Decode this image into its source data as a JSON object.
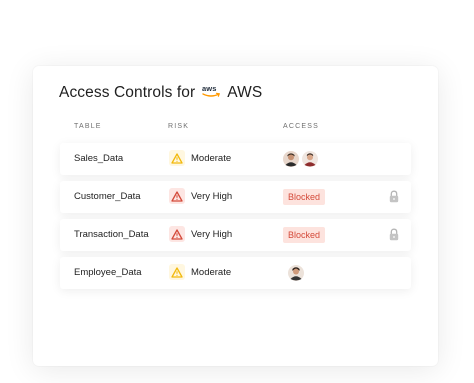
{
  "card": {
    "title": "Access Controls for",
    "provider_logo": "aws-logo",
    "provider_name": "AWS"
  },
  "columns": {
    "table": "TABLE",
    "risk": "RISK",
    "access": "ACCESS"
  },
  "rows": [
    {
      "table": "Sales_Data",
      "risk": "Moderate",
      "risk_level": "moderate",
      "access": "avatars",
      "avatars": 2,
      "locked": false
    },
    {
      "table": "Customer_Data",
      "risk": "Very High",
      "risk_level": "high",
      "access": "Blocked",
      "locked": true
    },
    {
      "table": "Transaction_Data",
      "risk": "Very High",
      "risk_level": "high",
      "access": "Blocked",
      "locked": true
    },
    {
      "table": "Employee_Data",
      "risk": "Moderate",
      "risk_level": "moderate",
      "access": "avatars",
      "avatars": 1,
      "locked": false
    }
  ],
  "colors": {
    "moderate": "#f2b90c",
    "high": "#d44a3a",
    "blocked_bg": "#fde3de",
    "blocked_text": "#d44a3a",
    "aws_orange": "#ff9900"
  }
}
